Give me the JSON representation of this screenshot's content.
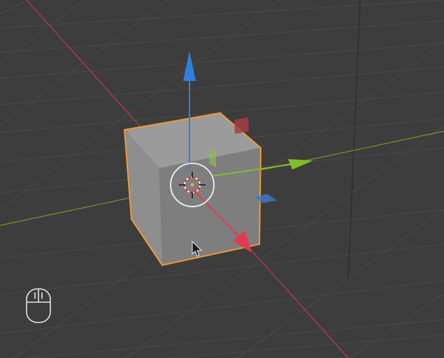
{
  "viewport": {
    "view": "3D Viewport",
    "shading": "solid",
    "selected_object": "cube",
    "active_tool": "move",
    "colors": {
      "background": "#3d3d3d",
      "grid_line": "#4a4a4a",
      "x_axis": "#d9344f",
      "y_axis": "#7fbf2a",
      "z_axis": "#2f7fe0",
      "selection_outline": "#ee9a3c",
      "cube_front": "#808080",
      "cube_top": "#9a9a9a",
      "cube_side": "#8c8c8c"
    }
  },
  "gizmo": {
    "handles": [
      "x-arrow-icon",
      "y-arrow-icon",
      "z-arrow-icon",
      "xy-plane-handle",
      "xz-plane-handle",
      "yz-plane-handle",
      "view-center-ring"
    ]
  },
  "overlay": {
    "mouse_icon": "mouse-icon",
    "cursor_icon": "arrow-cursor-icon"
  }
}
